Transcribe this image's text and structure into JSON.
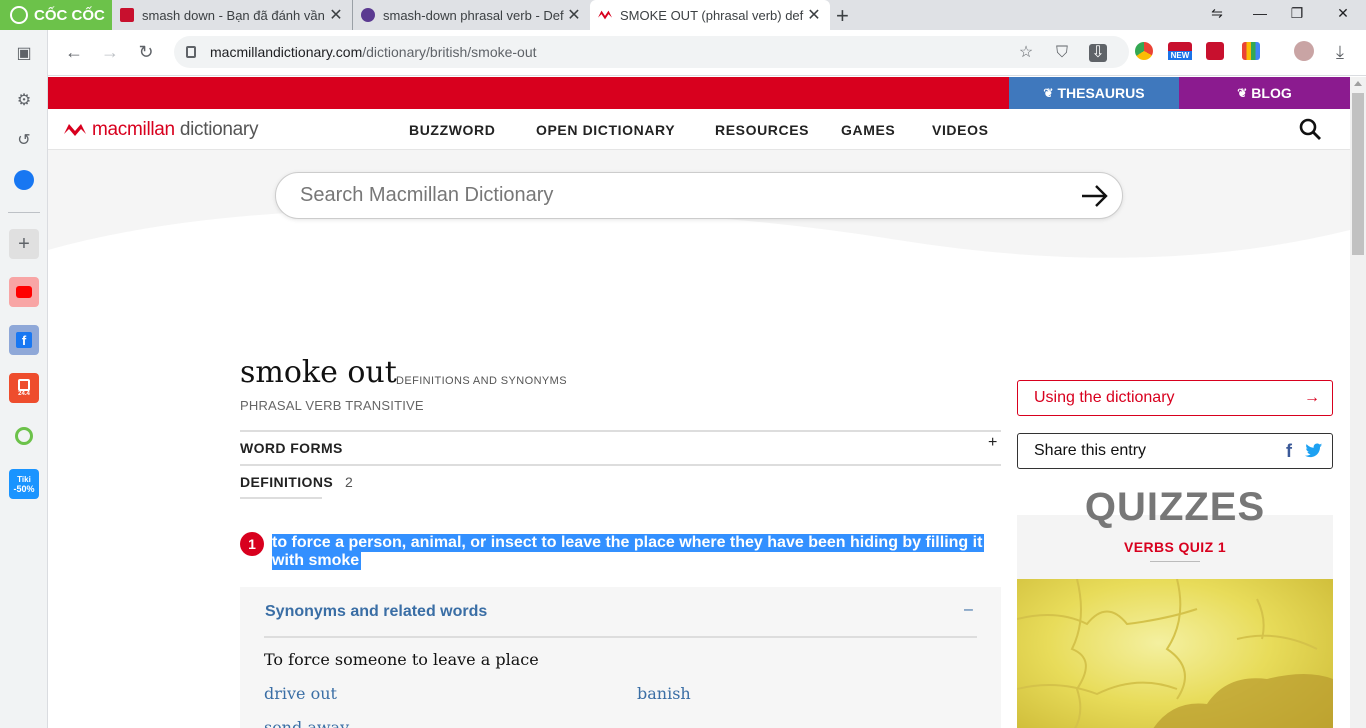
{
  "browser": {
    "brand": "CỐC CỐC",
    "tabs": [
      {
        "title": "smash down - Bạn đã đánh vần",
        "favicon_color": "#c8102e",
        "active": false
      },
      {
        "title": "smash-down phrasal verb - Defi",
        "favicon_color": "#5b3a91",
        "active": false
      },
      {
        "title": "SMOKE OUT (phrasal verb) defin",
        "favicon_color": "#d8001e",
        "active": true
      }
    ],
    "new_tab": "+",
    "url_host": "macmillandictionary.com",
    "url_path": "/dictionary/british/smoke-out",
    "extension_badge": "NEW",
    "sidebar_items": [
      "gear-icon",
      "history-icon",
      "messenger-icon",
      "add-icon",
      "youtube-icon",
      "facebook-icon",
      "shopee-icon",
      "sport-icon",
      "tiki-icon"
    ],
    "tiki_label": "Tiki",
    "tiki_badge": "-50%",
    "shopee_badge": "24.4"
  },
  "site": {
    "top_links": {
      "thesaurus": "THESAURUS",
      "blog": "BLOG"
    },
    "logo": {
      "part1": "macmillan",
      "part2": "dictionary"
    },
    "nav": [
      "BUZZWORD",
      "OPEN DICTIONARY",
      "RESOURCES",
      "GAMES",
      "VIDEOS"
    ],
    "search_placeholder": "Search Macmillan Dictionary",
    "accent_red": "#d8001e",
    "thesaurus_blue": "#3f78bd",
    "blog_purple": "#8b1b8f"
  },
  "entry": {
    "headword": "smoke out",
    "headword_tag": "DEFINITIONS AND SYNONYMS",
    "pos": "PHRASAL VERB  TRANSITIVE",
    "word_forms_label": "WORD FORMS",
    "word_forms_toggle": "+",
    "definitions_label": "DEFINITIONS",
    "definitions_count": "2",
    "sense": {
      "number": "1",
      "line1": "to force a person, animal, or insect to leave the place where they have been hiding by filling it",
      "line2": "with smoke"
    },
    "synonyms": {
      "title": "Synonyms and related words",
      "toggle": "–",
      "subheading": "To force someone to leave a place",
      "words": [
        "drive out",
        "banish",
        "send away"
      ]
    }
  },
  "sidebar_right": {
    "using": "Using the dictionary",
    "using_arrow": "→",
    "share": "Share this entry",
    "share_icons": [
      "facebook-icon",
      "twitter-icon"
    ],
    "quizzes_heading": "QUIZZES",
    "quiz_name": "VERBS QUIZ 1"
  }
}
